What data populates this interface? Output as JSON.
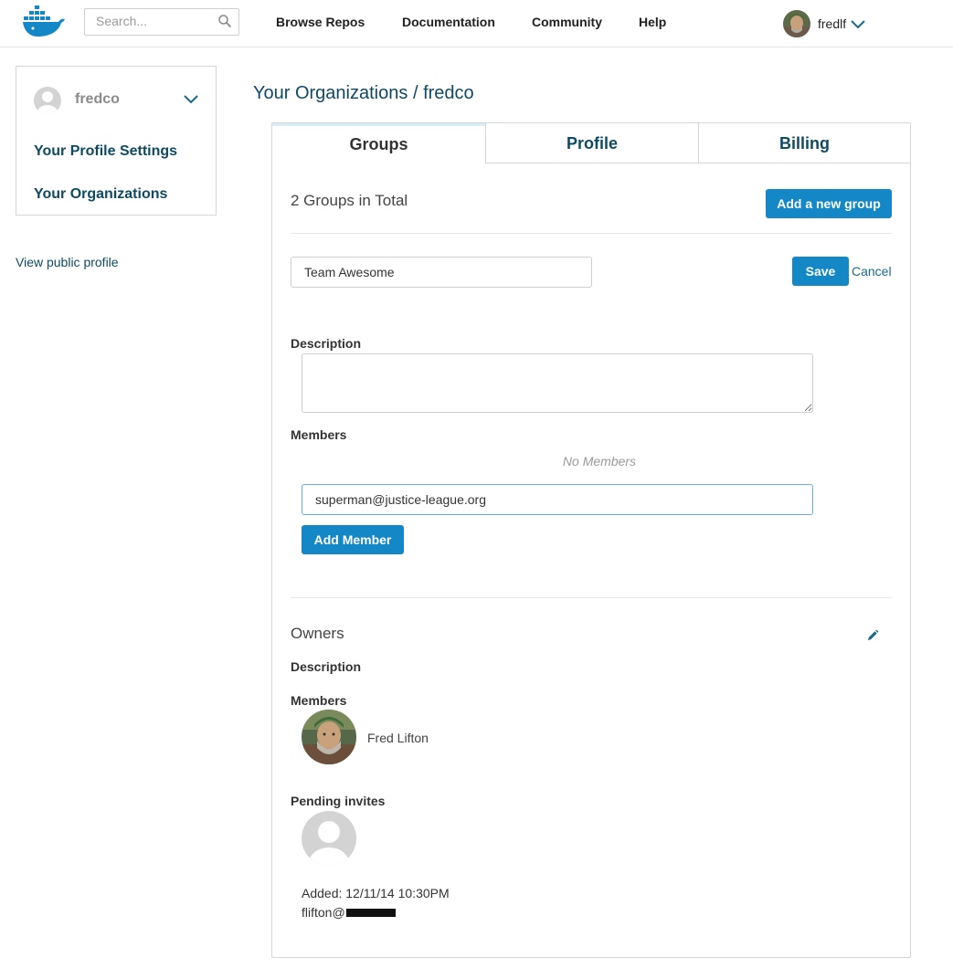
{
  "header": {
    "logo": "docker-whale-icon",
    "search": {
      "placeholder": "Search...",
      "value": ""
    },
    "nav": [
      "Browse Repos",
      "Documentation",
      "Community",
      "Help"
    ],
    "user": {
      "name": "fredlf"
    }
  },
  "sidebar": {
    "org_name": "fredco",
    "links": [
      "Your Profile Settings",
      "Your Organizations"
    ],
    "view_public_profile": "View public profile"
  },
  "page": {
    "breadcrumb_root": "Your Organizations",
    "breadcrumb_sep": "/",
    "breadcrumb_org": "fredco"
  },
  "tabs": {
    "groups": "Groups",
    "profile": "Profile",
    "billing": "Billing",
    "active": "Groups"
  },
  "groups": {
    "total_label": "2 Groups in Total",
    "add_group_button": "Add a new group",
    "edit_form": {
      "name_value": "Team Awesome",
      "save_label": "Save",
      "cancel_label": "Cancel",
      "description_label": "Description",
      "description_value": "",
      "members_label": "Members",
      "no_members_text": "No Members",
      "member_input_value": "superman@justice-league.org",
      "add_member_button": "Add Member"
    },
    "owners": {
      "title": "Owners",
      "description_label": "Description",
      "members_label": "Members",
      "member_name": "Fred Lifton",
      "pending_label": "Pending invites",
      "pending_added": "Added: 12/11/14 10:30PM",
      "pending_email_prefix": "flifton@"
    }
  },
  "colors": {
    "primary": "#1488c6",
    "link_dark": "#0e4a63",
    "border": "#d6d6d6"
  }
}
